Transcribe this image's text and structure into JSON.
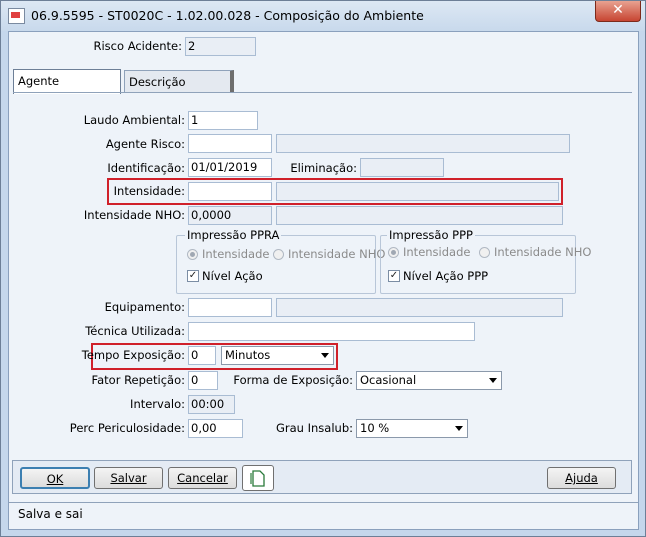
{
  "window": {
    "title": "06.9.5595 - ST0020C - 1.02.00.028 - Composição do Ambiente",
    "close_glyph": "✕"
  },
  "header": {
    "risco_acidente_label": "Risco Acidente:",
    "risco_acidente_value": "2"
  },
  "tabs": [
    {
      "label": "Agente",
      "active": true
    },
    {
      "label": "Descrição",
      "active": false
    }
  ],
  "form": {
    "laudo_label": "Laudo Ambiental:",
    "laudo_value": "1",
    "agente_label": "Agente Risco:",
    "agente_value": "",
    "identificacao_label": "Identificação:",
    "identificacao_value": "01/01/2019",
    "eliminacao_label": "Eliminação:",
    "eliminacao_value": "",
    "intensidade_label": "Intensidade:",
    "intensidade_value": "",
    "intensidade_nho_label": "Intensidade NHO:",
    "intensidade_nho_value": "0,0000",
    "equipamento_label": "Equipamento:",
    "equipamento_value": "",
    "tecnica_label": "Técnica Utilizada:",
    "tecnica_value": "",
    "tempo_label": "Tempo Exposição:",
    "tempo_value": "0",
    "tempo_unit": "Minutos",
    "fator_label": "Fator Repetição:",
    "fator_value": "0",
    "forma_label": "Forma de Exposição:",
    "forma_value": "Ocasional",
    "intervalo_label": "Intervalo:",
    "intervalo_value": "00:00",
    "perc_label": "Perc Periculosidade:",
    "perc_value": "0,00",
    "grau_label": "Grau Insalub:",
    "grau_value": "10 %"
  },
  "ppra": {
    "title": "Impressão PPRA",
    "radio1": "Intensidade",
    "radio2": "Intensidade NHO",
    "check": "Nível Ação",
    "check_glyph": "✓"
  },
  "ppp": {
    "title": "Impressão PPP",
    "radio1": "Intensidade",
    "radio2": "Intensidade NHO",
    "check": "Nível Ação PPP",
    "check_glyph": "✓"
  },
  "buttons": {
    "ok": "OK",
    "salvar": "Salvar",
    "cancelar": "Cancelar",
    "ajuda": "Ajuda"
  },
  "status": {
    "text": "Salva e sai"
  },
  "colors": {
    "highlight_border": "#d0202a",
    "accent": "#c5d7ec"
  }
}
